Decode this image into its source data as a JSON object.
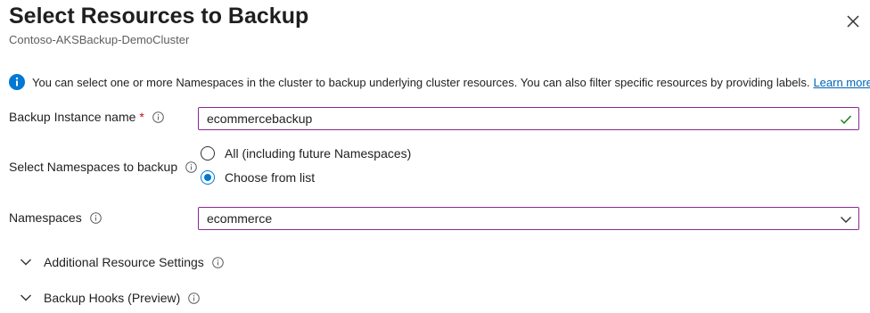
{
  "header": {
    "title": "Select Resources to Backup",
    "subtitle": "Contoso-AKSBackup-DemoCluster"
  },
  "info": {
    "message": "You can select one or more Namespaces in the cluster to backup underlying cluster resources. You can also filter specific resources by providing labels.",
    "link_label": "Learn more"
  },
  "form": {
    "backup_instance_name": {
      "label": "Backup Instance name",
      "required_marker": "*",
      "value": "ecommercebackup",
      "status_icon": "checkmark-icon"
    },
    "namespaces_selection": {
      "label": "Select Namespaces to backup",
      "options": [
        {
          "label": "All (including future Namespaces)",
          "selected": false
        },
        {
          "label": "Choose from list",
          "selected": true
        }
      ]
    },
    "namespaces": {
      "label": "Namespaces",
      "value": "ecommerce"
    }
  },
  "sections": [
    {
      "label": "Additional Resource Settings"
    },
    {
      "label": "Backup Hooks (Preview)"
    }
  ],
  "colors": {
    "accent": "#0078d4",
    "field_border": "#8a2a8e",
    "required": "#c50f1f",
    "valid": "#107c10",
    "link": "#0064b4"
  }
}
